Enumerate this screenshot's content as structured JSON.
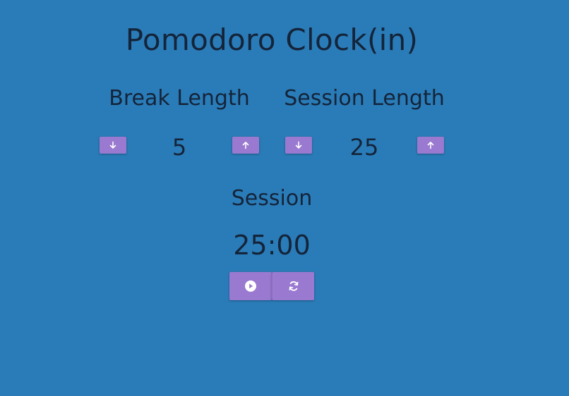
{
  "app": {
    "title": "Pomodoro Clock(in)"
  },
  "break": {
    "label": "Break Length",
    "value": "5",
    "decrement_icon": "arrow-down-icon",
    "increment_icon": "arrow-up-icon"
  },
  "session": {
    "label": "Session Length",
    "value": "25",
    "decrement_icon": "arrow-down-icon",
    "increment_icon": "arrow-up-icon"
  },
  "timer": {
    "label": "Session",
    "time_left": "25:00"
  },
  "controls": {
    "start_stop_icon": "play-circle-icon",
    "reset_icon": "refresh-icon"
  },
  "colors": {
    "background": "#2a7cb8",
    "button": "#9a79d0",
    "text": "#14243a",
    "icon": "#ffffff"
  }
}
